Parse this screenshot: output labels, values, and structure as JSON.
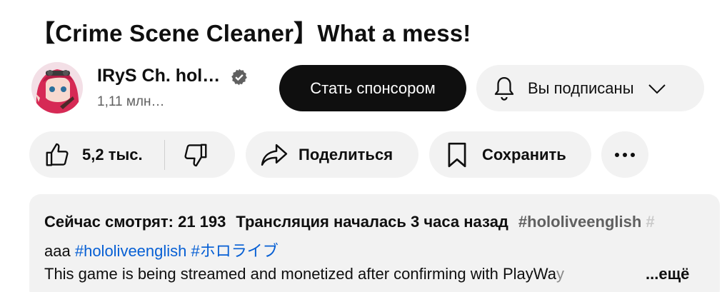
{
  "video": {
    "title": "【Crime Scene Cleaner】What a mess!"
  },
  "channel": {
    "name": "IRyS Ch. hol…",
    "subscribers": "1,11 млн…",
    "verified_icon": "verified-icon"
  },
  "buttons": {
    "sponsor_label": "Стать спонсором",
    "subscribed_label": "Вы подписаны",
    "like_count": "5,2 тыс.",
    "share_label": "Поделиться",
    "save_label": "Сохранить",
    "more_icon": "more-horizontal-icon"
  },
  "description": {
    "viewers": "Сейчас смотрят: 21 193",
    "started": "Трансляция началась 3 часа назад",
    "tag_header": "#hololiveenglish",
    "tag_header_cut": "#",
    "line2_text": "aaa",
    "line2_tag1": "#hololiveenglish",
    "line2_tag2": "#ホロライブ",
    "body_text": "This game is being streamed and monetized after confirming with PlayWa",
    "body_text_fade": "y",
    "more_label": "...ещё"
  },
  "colors": {
    "primary_button": "#0f0f0f",
    "chip_background": "#f2f2f2",
    "link": "#065fd4",
    "secondary_text": "#606060"
  }
}
